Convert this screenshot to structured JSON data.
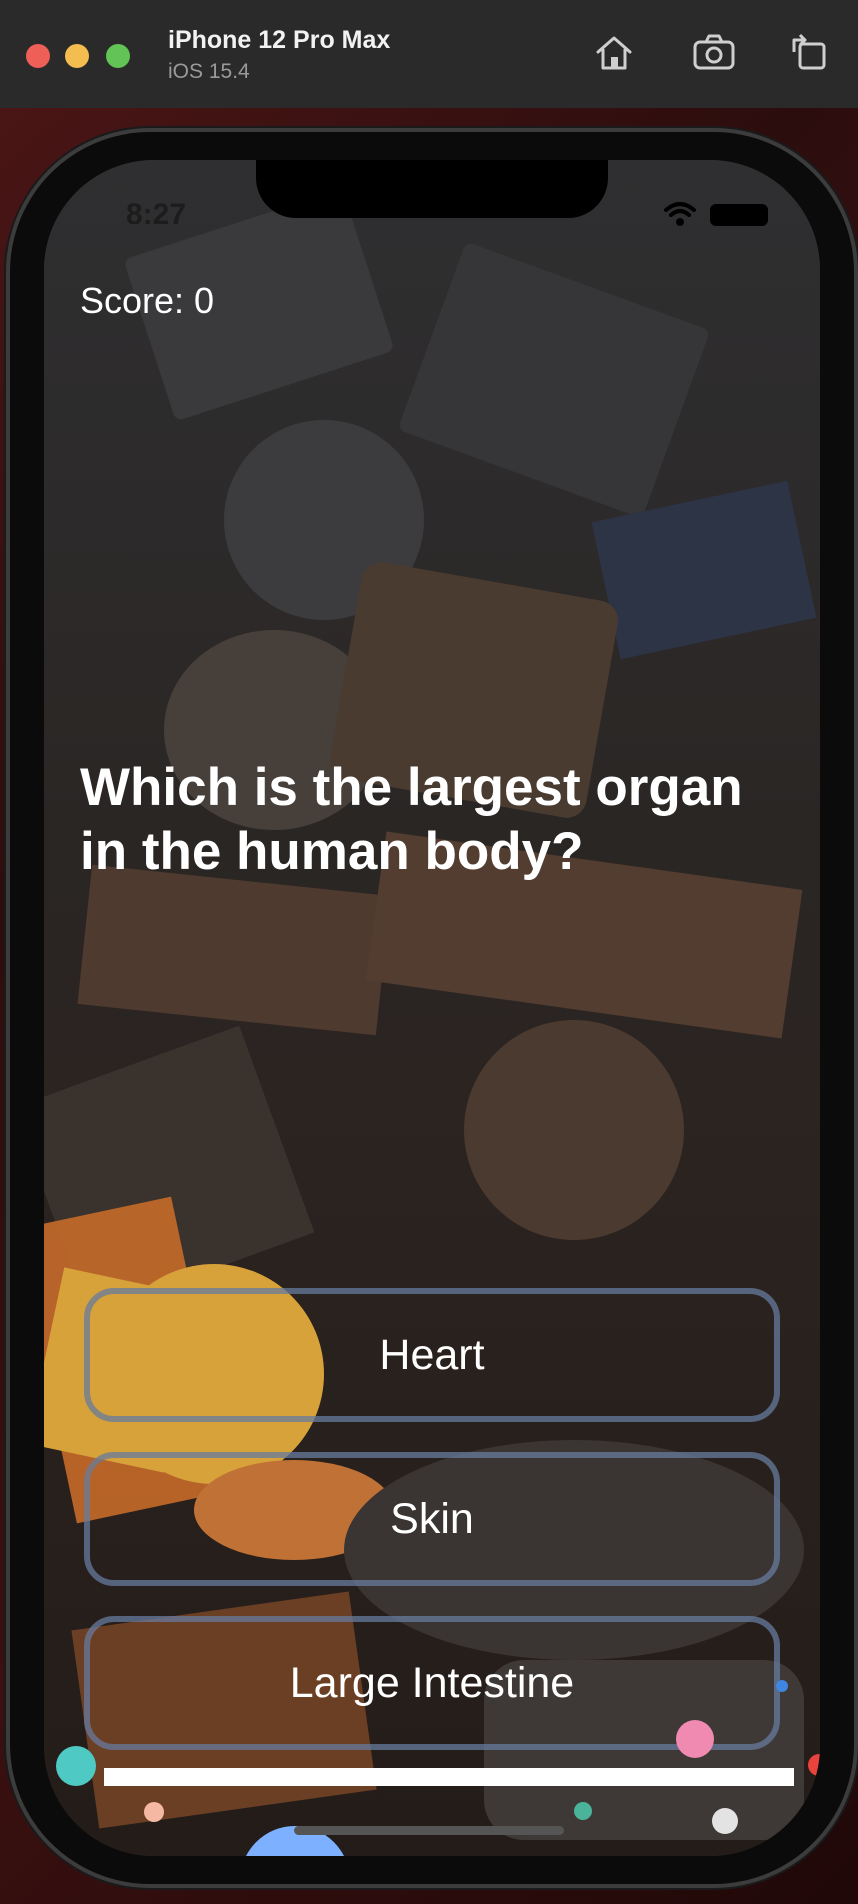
{
  "window": {
    "device_name": "iPhone 12 Pro Max",
    "os_version": "iOS 15.4",
    "toolbar_icons": [
      "home-icon",
      "screenshot-camera-icon",
      "rotate-icon"
    ]
  },
  "status_bar": {
    "time": "8:27",
    "icons": [
      "cellular-dots-icon",
      "wifi-icon",
      "battery-icon"
    ]
  },
  "game": {
    "score_label": "Score: 0",
    "question": "Which is the largest organ in the human body?",
    "answers": [
      "Heart",
      "Skin",
      "Large Intestine"
    ],
    "progress": 1.0
  },
  "colors": {
    "answer_border": "#677b9e",
    "text": "#ffffff",
    "progress_bar": "#ffffff",
    "confetti": [
      "#4fc9c3",
      "#f08ab0",
      "#f5b9a3",
      "#4bb39a",
      "#e3e3e3",
      "#3f86e0",
      "#7db0ff",
      "#e8433d",
      "#f3b33a"
    ]
  }
}
